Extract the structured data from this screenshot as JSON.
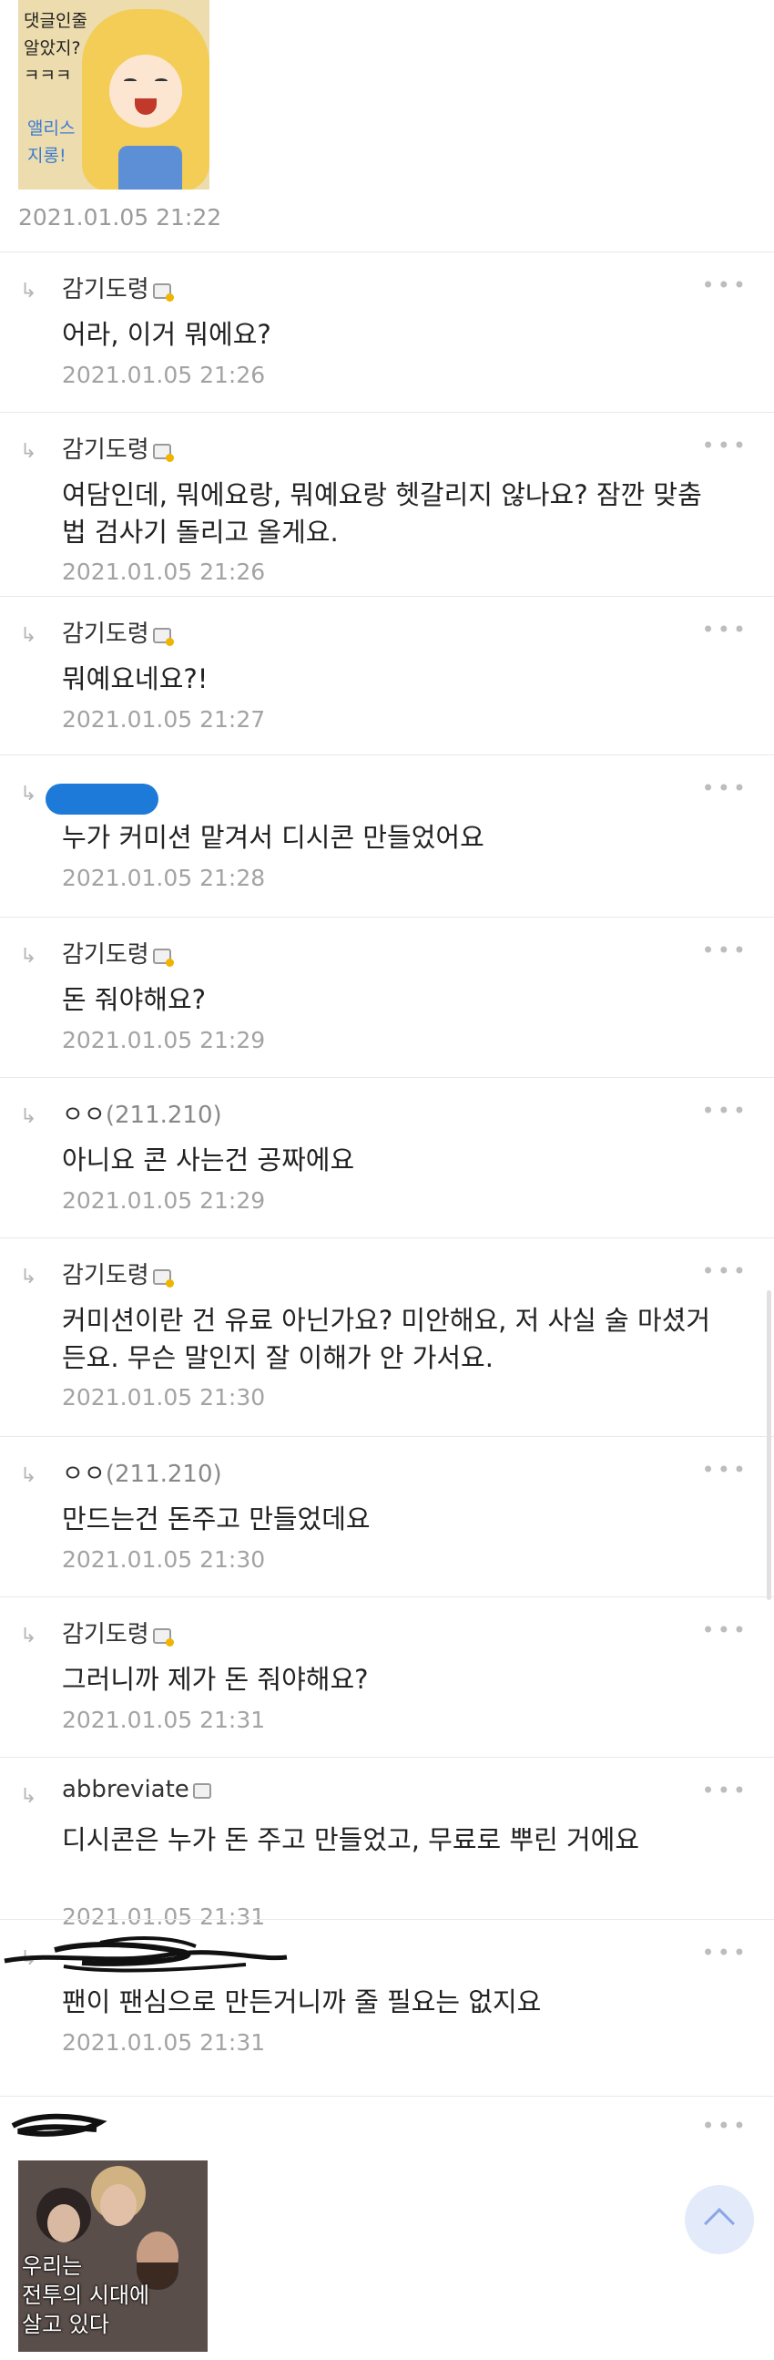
{
  "top_comment": {
    "dccon_text": "댓글인줄\n알았지?\nㅋㅋㅋ",
    "dccon_text2": "앨리스\n지롱!",
    "date": "2021.01.05 21:22"
  },
  "replies": [
    {
      "nick": "감기도령",
      "ip": "",
      "body": "어라, 이거 뭐에요?",
      "date": "2021.01.05 21:26"
    },
    {
      "nick": "감기도령",
      "ip": "",
      "body": "여담인데, 뭐에요랑, 뭐예요랑 헷갈리지 않나요? 잠깐 맞춤법 검사기 돌리고 올게요.",
      "date": "2021.01.05 21:26"
    },
    {
      "nick": "감기도령",
      "ip": "",
      "body": "뭐예요네요?!",
      "date": "2021.01.05 21:27"
    },
    {
      "nick": "",
      "ip": "",
      "body": "누가 커미션 맡겨서 디시콘 만들었어요",
      "date": "2021.01.05 21:28"
    },
    {
      "nick": "감기도령",
      "ip": "",
      "body": "돈 줘야해요?",
      "date": "2021.01.05 21:29"
    },
    {
      "nick": "ㅇㅇ",
      "ip": "(211.210)",
      "body": "아니요 콘 사는건 공짜에요",
      "date": "2021.01.05 21:29"
    },
    {
      "nick": "감기도령",
      "ip": "",
      "body": "커미션이란 건 유료 아닌가요? 미안해요, 저 사실 술 마셨거든요. 무슨 말인지 잘 이해가 안 가서요.",
      "date": "2021.01.05 21:30"
    },
    {
      "nick": "ㅇㅇ",
      "ip": "(211.210)",
      "body": "만드는건 돈주고 만들었데요",
      "date": "2021.01.05 21:30"
    },
    {
      "nick": "감기도령",
      "ip": "",
      "body": "그러니까 제가 돈 줘야해요?",
      "date": "2021.01.05 21:31"
    },
    {
      "nick": "abbreviate",
      "ip": "",
      "body": "디시콘은 누가 돈 주고 만들었고, 무료로 뿌린 거에요",
      "date": "2021.01.05 21:31"
    },
    {
      "nick": "",
      "ip": "",
      "body": "팬이 팬심으로 만든거니까 줄 필요는 없지요",
      "date": "2021.01.05 21:31"
    }
  ],
  "bottom_comment": {
    "dccon_caption": "우리는\n전투의 시대에\n살고 있다"
  },
  "icons": {
    "reply_arrow": "↳",
    "more": "•••"
  }
}
